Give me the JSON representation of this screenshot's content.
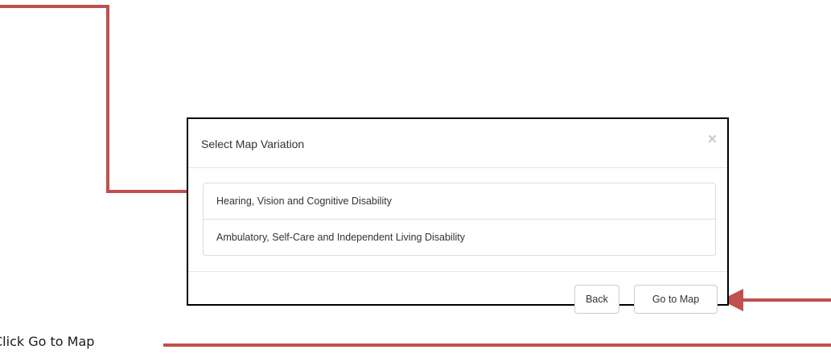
{
  "dialog": {
    "title": "Select Map Variation",
    "close_symbol": "×",
    "options": [
      {
        "label": "Hearing, Vision and Cognitive Disability"
      },
      {
        "label": "Ambulatory, Self-Care and Independent Living Disability"
      }
    ],
    "back_label": "Back",
    "go_label": "Go to Map"
  },
  "annotation": {
    "instruction": "Click Go to Map",
    "arrow_color": "#c0504d"
  }
}
